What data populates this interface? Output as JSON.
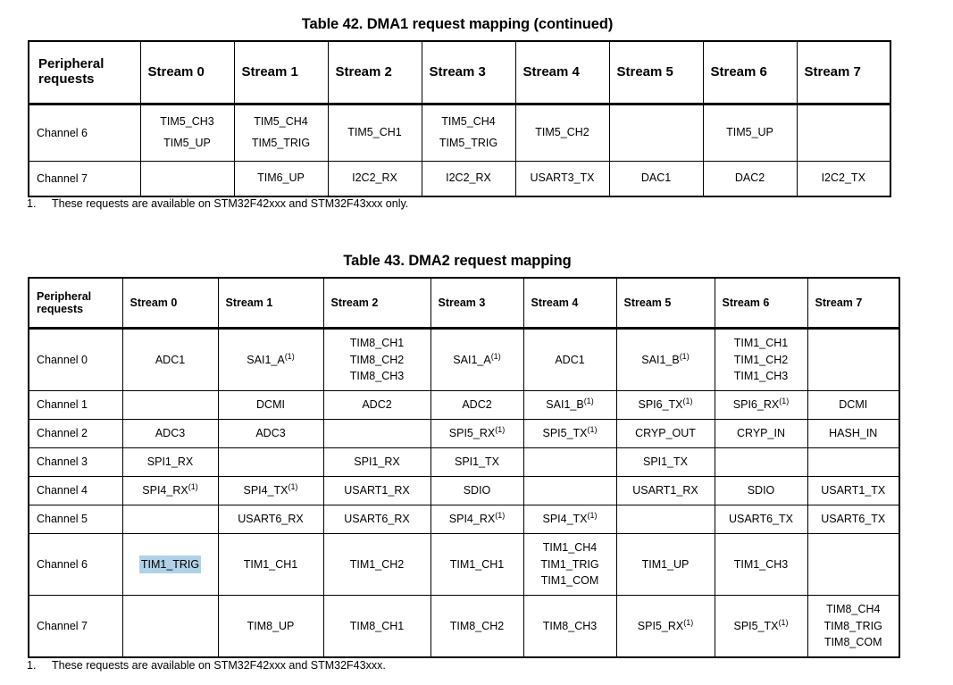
{
  "table42": {
    "title": "Table 42. DMA1 request mapping (continued)",
    "columns": [
      "Peripheral requests",
      "Stream 0",
      "Stream 1",
      "Stream 2",
      "Stream 3",
      "Stream 4",
      "Stream 5",
      "Stream 6",
      "Stream 7"
    ],
    "first_column_line1": "Peripheral",
    "first_column_line2": "requests",
    "rows": [
      {
        "label": "Channel 6",
        "cells": [
          [
            "TIM5_CH3",
            "TIM5_UP"
          ],
          [
            "TIM5_CH4",
            "TIM5_TRIG"
          ],
          [
            "TIM5_CH1"
          ],
          [
            "TIM5_CH4",
            "TIM5_TRIG"
          ],
          [
            "TIM5_CH2"
          ],
          [],
          [
            "TIM5_UP"
          ],
          []
        ]
      },
      {
        "label": "Channel 7",
        "cells": [
          [],
          [
            "TIM6_UP"
          ],
          [
            "I2C2_RX"
          ],
          [
            "I2C2_RX"
          ],
          [
            "USART3_TX"
          ],
          [
            "DAC1"
          ],
          [
            "DAC2"
          ],
          [
            "I2C2_TX"
          ]
        ]
      }
    ],
    "footnote": {
      "number": "1.",
      "text": "These requests are available on STM32F42xxx and STM32F43xxx only."
    }
  },
  "table43": {
    "title": "Table 43. DMA2 request mapping",
    "columns": [
      "Peripheral requests",
      "Stream 0",
      "Stream 1",
      "Stream 2",
      "Stream 3",
      "Stream 4",
      "Stream 5",
      "Stream 6",
      "Stream 7"
    ],
    "first_column_line1": "Peripheral",
    "first_column_line2": "requests",
    "rows": [
      {
        "label": "Channel 0",
        "cells": [
          [
            "ADC1"
          ],
          [
            "SAI1_A(1)"
          ],
          [
            "TIM8_CH1",
            "TIM8_CH2",
            "TIM8_CH3"
          ],
          [
            "SAI1_A(1)"
          ],
          [
            "ADC1"
          ],
          [
            "SAI1_B(1)"
          ],
          [
            "TIM1_CH1",
            "TIM1_CH2",
            "TIM1_CH3"
          ],
          []
        ]
      },
      {
        "label": "Channel 1",
        "cells": [
          [],
          [
            "DCMI"
          ],
          [
            "ADC2"
          ],
          [
            "ADC2"
          ],
          [
            "SAI1_B(1)"
          ],
          [
            "SPI6_TX(1)"
          ],
          [
            "SPI6_RX(1)"
          ],
          [
            "DCMI"
          ]
        ]
      },
      {
        "label": "Channel 2",
        "cells": [
          [
            "ADC3"
          ],
          [
            "ADC3"
          ],
          [],
          [
            "SPI5_RX(1)"
          ],
          [
            "SPI5_TX(1)"
          ],
          [
            "CRYP_OUT"
          ],
          [
            "CRYP_IN"
          ],
          [
            "HASH_IN"
          ]
        ]
      },
      {
        "label": "Channel 3",
        "cells": [
          [
            "SPI1_RX"
          ],
          [],
          [
            "SPI1_RX"
          ],
          [
            "SPI1_TX"
          ],
          [],
          [
            "SPI1_TX"
          ],
          [],
          []
        ]
      },
      {
        "label": "Channel 4",
        "cells": [
          [
            "SPI4_RX(1)"
          ],
          [
            "SPI4_TX(1)"
          ],
          [
            "USART1_RX"
          ],
          [
            "SDIO"
          ],
          [],
          [
            "USART1_RX"
          ],
          [
            "SDIO"
          ],
          [
            "USART1_TX"
          ]
        ]
      },
      {
        "label": "Channel 5",
        "cells": [
          [],
          [
            "USART6_RX"
          ],
          [
            "USART6_RX"
          ],
          [
            "SPI4_RX(1)"
          ],
          [
            "SPI4_TX(1)"
          ],
          [],
          [
            "USART6_TX"
          ],
          [
            "USART6_TX"
          ]
        ]
      },
      {
        "label": "Channel 6",
        "cells": [
          [
            "TIM1_TRIG"
          ],
          [
            "TIM1_CH1"
          ],
          [
            "TIM1_CH2"
          ],
          [
            "TIM1_CH1"
          ],
          [
            "TIM1_CH4",
            "TIM1_TRIG",
            "TIM1_COM"
          ],
          [
            "TIM1_UP"
          ],
          [
            "TIM1_CH3"
          ],
          []
        ]
      },
      {
        "label": "Channel 7",
        "cells": [
          [],
          [
            "TIM8_UP"
          ],
          [
            "TIM8_CH1"
          ],
          [
            "TIM8_CH2"
          ],
          [
            "TIM8_CH3"
          ],
          [
            "SPI5_RX(1)"
          ],
          [
            "SPI5_TX(1)"
          ],
          [
            "TIM8_CH4",
            "TIM8_TRIG",
            "TIM8_COM"
          ]
        ]
      }
    ],
    "footnote": {
      "number": "1.",
      "text": "These requests are available on STM32F42xxx and STM32F43xxx."
    },
    "selection": {
      "row": "Channel 6",
      "column": "Stream 0",
      "text": "TIM1_TRIG",
      "highlight_color": "#b0d2e8"
    }
  }
}
